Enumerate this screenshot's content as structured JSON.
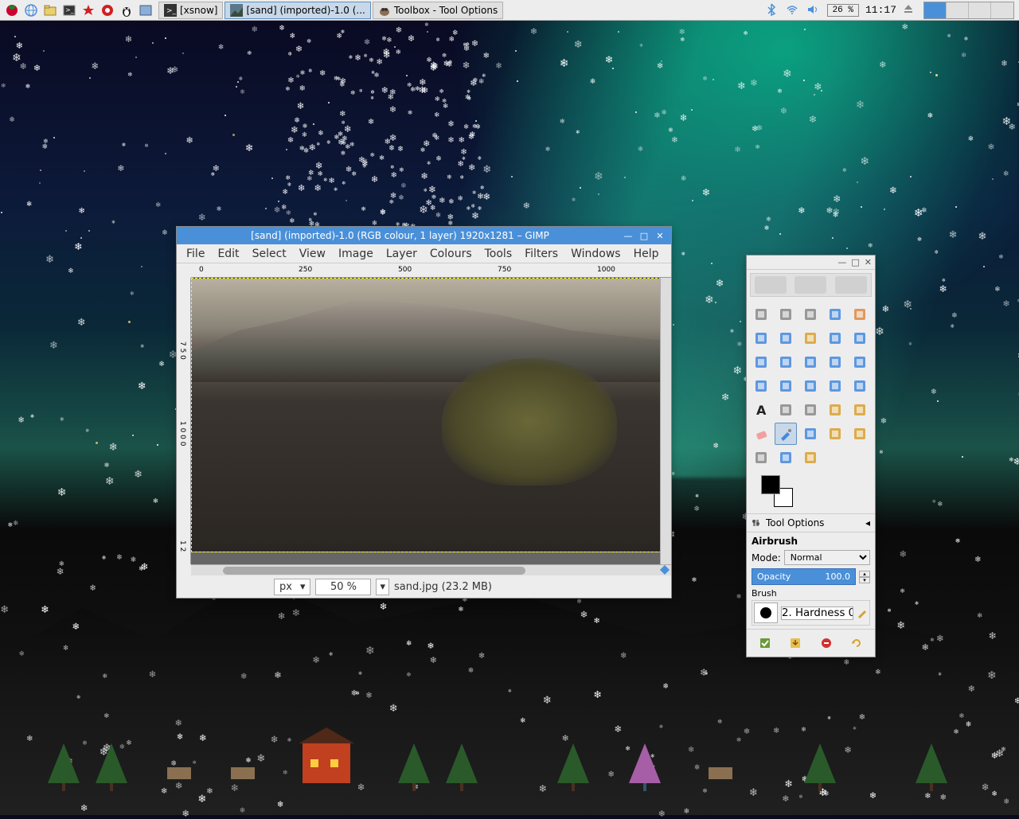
{
  "panel": {
    "taskbar": [
      {
        "label": "[xsnow]",
        "icon": "terminal"
      },
      {
        "label": "[sand] (imported)-1.0 (...",
        "icon": "image"
      },
      {
        "label": "Toolbox - Tool Options",
        "icon": "gimp"
      }
    ],
    "battery": "26 %",
    "clock": "11:17"
  },
  "gimp_window": {
    "title": "[sand] (imported)-1.0 (RGB colour, 1 layer) 1920x1281 – GIMP",
    "menus": [
      "File",
      "Edit",
      "Select",
      "View",
      "Image",
      "Layer",
      "Colours",
      "Tools",
      "Filters",
      "Windows",
      "Help"
    ],
    "ruler_h": [
      "0",
      "250",
      "500",
      "750",
      "1000"
    ],
    "ruler_v_a": "7\n5\n0",
    "ruler_v_b": "1\n0\n0\n0",
    "ruler_v_c": "1\n2",
    "status": {
      "unit": "px",
      "zoom": "50 %",
      "file_info": "sand.jpg (23.2 MB)"
    }
  },
  "toolbox": {
    "tools": [
      "rectangle-select",
      "ellipse-select",
      "free-select",
      "fuzzy-select",
      "select-by-color",
      "scissors",
      "foreground-select",
      "paths",
      "color-picker",
      "zoom",
      "measure",
      "move",
      "align",
      "crop",
      "rotate",
      "scale",
      "shear",
      "perspective",
      "flip",
      "cage",
      "text",
      "bucket-fill",
      "blend",
      "pencil",
      "paintbrush",
      "eraser",
      "airbrush",
      "ink",
      "clone",
      "heal",
      "smudge",
      "blur",
      "dodge"
    ],
    "selected_tool": "airbrush",
    "options_title": "Tool Options",
    "tool_name": "Airbrush",
    "mode_label": "Mode:",
    "mode_value": "Normal",
    "opacity_label": "Opacity",
    "opacity_value": "100.0",
    "brush_label": "Brush",
    "brush_value": "2. Hardness 0"
  }
}
